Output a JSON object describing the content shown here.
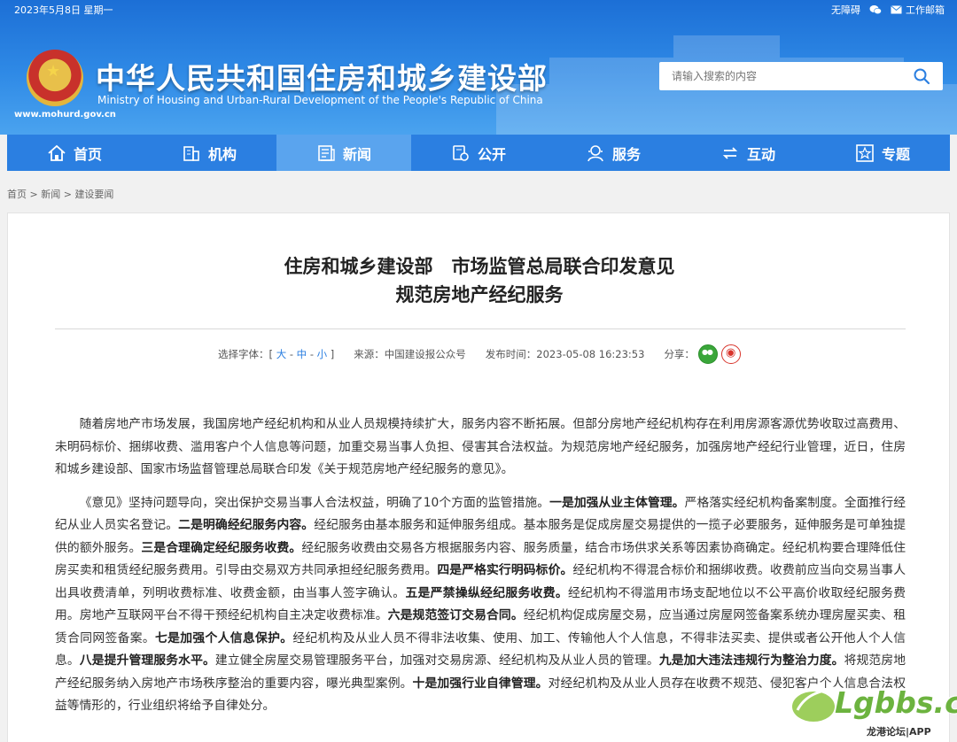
{
  "topbar": {
    "date": "2023年5月8日 星期一",
    "accessibility": "无障碍",
    "work_mail": "工作邮箱"
  },
  "header": {
    "title": "中华人民共和国住房和城乡建设部",
    "subtitle": "Ministry of Housing and Urban-Rural Development of the People's Republic of China",
    "url": "www.mohurd.gov.cn",
    "search_placeholder": "请输入搜索的内容"
  },
  "nav": {
    "items": [
      {
        "label": "首页",
        "icon": "home-icon"
      },
      {
        "label": "机构",
        "icon": "building-icon"
      },
      {
        "label": "新闻",
        "icon": "news-icon",
        "active": true
      },
      {
        "label": "公开",
        "icon": "document-icon"
      },
      {
        "label": "服务",
        "icon": "service-icon"
      },
      {
        "label": "互动",
        "icon": "interaction-icon"
      },
      {
        "label": "专题",
        "icon": "star-icon"
      }
    ]
  },
  "breadcrumb": {
    "home": "首页",
    "news": "新闻",
    "current": "建设要闻",
    "sep": ">"
  },
  "article": {
    "title_line1": "住房和城乡建设部　市场监管总局联合印发意见",
    "title_line2": "规范房地产经纪服务",
    "font_label": "选择字体：[",
    "font_large": "大",
    "font_medium": "中",
    "font_small": "小",
    "font_close": "]",
    "font_dash": "-",
    "source": "来源：中国建设报公众号",
    "publish_time": "发布时间：2023-05-08 16:23:53",
    "share_label": "分享：",
    "paragraph1": "随着房地产市场发展，我国房地产经纪机构和从业人员规模持续扩大，服务内容不断拓展。但部分房地产经纪机构存在利用房源客源优势收取过高费用、未明码标价、捆绑收费、滥用客户个人信息等问题，加重交易当事人负担、侵害其合法权益。为规范房地产经纪服务，加强房地产经纪行业管理，近日，住房和城乡建设部、国家市场监督管理总局联合印发《关于规范房地产经纪服务的意见》。",
    "p2": {
      "s0": "《意见》坚持问题导向，突出保护交易当事人合法权益，明确了10个方面的监管措施。",
      "b1": "一是加强从业主体管理。",
      "s1": "严格落实经纪机构备案制度。全面推行经纪从业人员实名登记。",
      "b2": "二是明确经纪服务内容。",
      "s2": "经纪服务由基本服务和延伸服务组成。基本服务是促成房屋交易提供的一揽子必要服务，延伸服务是可单独提供的额外服务。",
      "b3": "三是合理确定经纪服务收费。",
      "s3": "经纪服务收费由交易各方根据服务内容、服务质量，结合市场供求关系等因素协商确定。经纪机构要合理降低住房买卖和租赁经纪服务费用。引导由交易双方共同承担经纪服务费用。",
      "b4": "四是严格实行明码标价。",
      "s4": "经纪机构不得混合标价和捆绑收费。收费前应当向交易当事人出具收费清单，列明收费标准、收费金额，由当事人签字确认。",
      "b5": "五是严禁操纵经纪服务收费。",
      "s5": "经纪机构不得滥用市场支配地位以不公平高价收取经纪服务费用。房地产互联网平台不得干预经纪机构自主决定收费标准。",
      "b6": "六是规范签订交易合同。",
      "s6": "经纪机构促成房屋交易，应当通过房屋网签备案系统办理房屋买卖、租赁合同网签备案。",
      "b7": "七是加强个人信息保护。",
      "s7": "经纪机构及从业人员不得非法收集、使用、加工、传输他人个人信息，不得非法买卖、提供或者公开他人个人信息。",
      "b8": "八是提升管理服务水平。",
      "s8": "建立健全房屋交易管理服务平台，加强对交易房源、经纪机构及从业人员的管理。",
      "b9": "九是加大违法违规行为整治力度。",
      "s9": "将规范房地产经纪服务纳入房地产市场秩序整治的重要内容，曝光典型案例。",
      "b10": "十是加强行业自律管理。",
      "s10": "对经纪机构及从业人员存在收费不规范、侵犯客户个人信息合法权益等情形的，行业组织将给予自律处分。"
    }
  },
  "watermark": {
    "text": "Lgbbs.cn",
    "sub": "龙港论坛|APP"
  },
  "colors": {
    "header_blue": "#2f8ae6",
    "nav_blue": "#2b7fe1",
    "nav_active": "#5aa4ee",
    "link_blue": "#2b7fe1",
    "wechat_green": "#3aa63a",
    "weibo_red": "#d8342b"
  }
}
